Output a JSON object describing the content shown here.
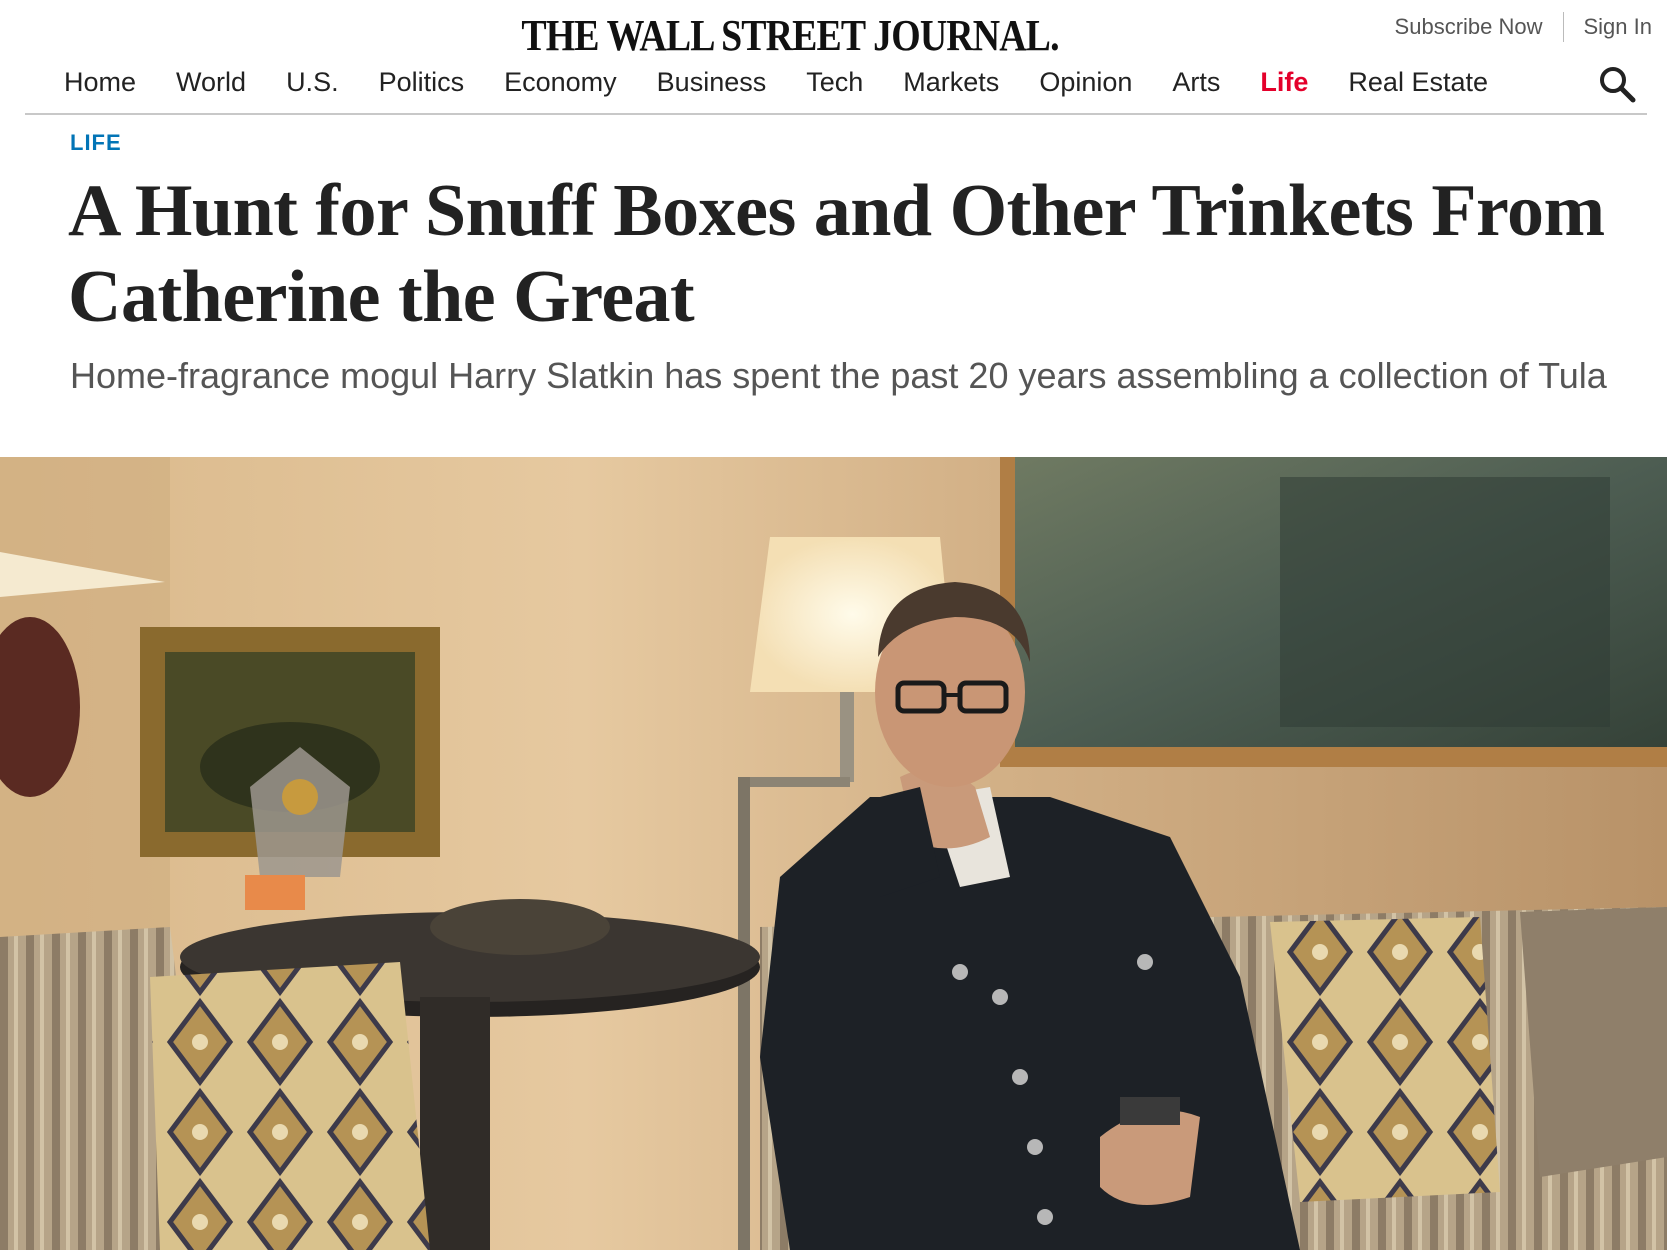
{
  "header": {
    "masthead": "THE WALL STREET JOURNAL.",
    "subscribe_label": "Subscribe Now",
    "signin_label": "Sign In"
  },
  "nav": {
    "items": [
      {
        "label": "Home"
      },
      {
        "label": "World"
      },
      {
        "label": "U.S."
      },
      {
        "label": "Politics"
      },
      {
        "label": "Economy"
      },
      {
        "label": "Business"
      },
      {
        "label": "Tech"
      },
      {
        "label": "Markets"
      },
      {
        "label": "Opinion"
      },
      {
        "label": "Arts"
      },
      {
        "label": "Life",
        "active": true
      },
      {
        "label": "Real Estate"
      }
    ],
    "search_icon": "search-icon"
  },
  "article": {
    "category": "LIFE",
    "headline": "A Hunt for Snuff Boxes and Other Trinkets From Catherine the Great",
    "dek": "Home-fragrance mogul Harry Slatkin has spent the past 20 years assembling a collection of Tula"
  },
  "colors": {
    "accent_life": "#e4002b",
    "category_blue": "#0274b6",
    "headline": "#222222",
    "dek": "#555555"
  }
}
